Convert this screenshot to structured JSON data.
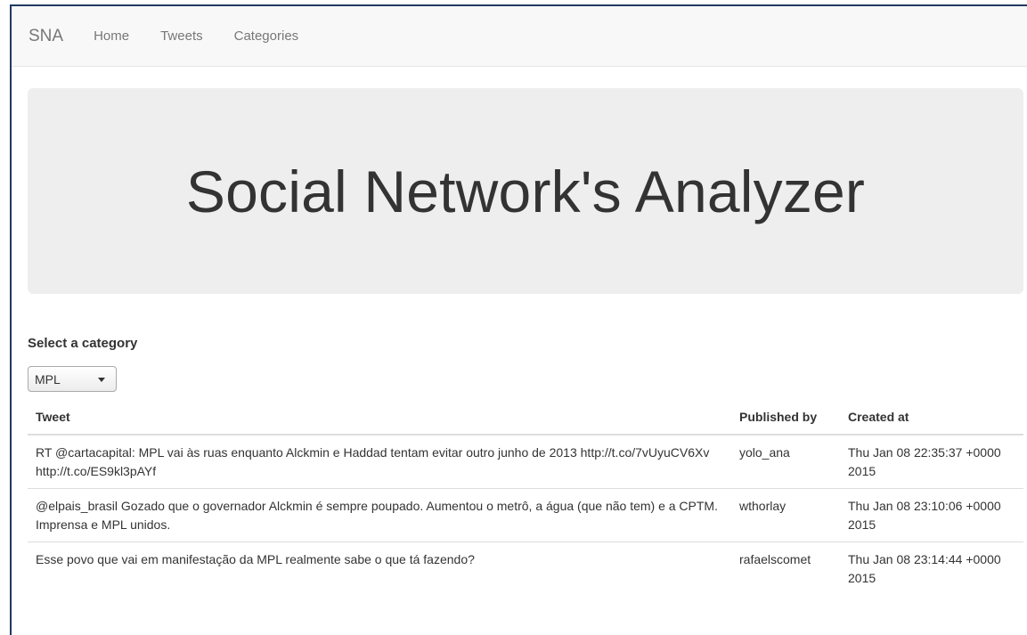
{
  "navbar": {
    "brand": "SNA",
    "links": [
      "Home",
      "Tweets",
      "Categories"
    ]
  },
  "jumbotron": {
    "title": "Social Network's Analyzer"
  },
  "category": {
    "label": "Select a category",
    "selected": "MPL"
  },
  "table": {
    "headers": {
      "tweet": "Tweet",
      "published_by": "Published by",
      "created_at": "Created at"
    },
    "rows": [
      {
        "tweet": "RT @cartacapital: MPL vai às ruas enquanto Alckmin e Haddad tentam evitar outro junho de 2013 http://t.co/7vUyuCV6Xv http://t.co/ES9kl3pAYf",
        "published_by": "yolo_ana",
        "created_at": "Thu Jan 08 22:35:37 +0000 2015"
      },
      {
        "tweet": "@elpais_brasil Gozado que o governador Alckmin é sempre poupado. Aumentou o metrô, a água (que não tem) e a CPTM. Imprensa e MPL unidos.",
        "published_by": "wthorlay",
        "created_at": "Thu Jan 08 23:10:06 +0000 2015"
      },
      {
        "tweet": "Esse povo que vai em manifestação da MPL realmente sabe o que tá fazendo?",
        "published_by": "rafaelscomet",
        "created_at": "Thu Jan 08 23:14:44 +0000 2015"
      }
    ]
  }
}
